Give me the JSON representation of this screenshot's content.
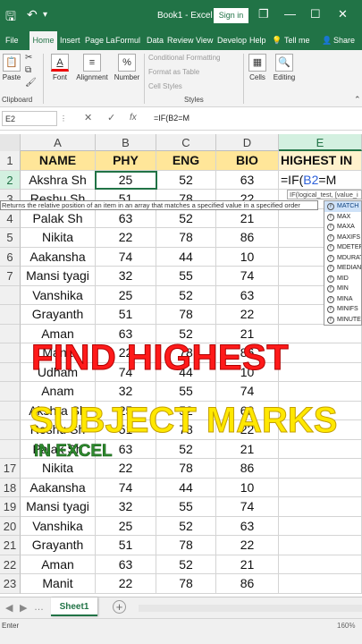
{
  "titlebar": {
    "title": "Book1 - Excel",
    "signin": "Sign in",
    "save_glyph": "🖫",
    "undo_glyph": "↶",
    "more_glyph": "▾",
    "restore_glyph": "❐",
    "minimize_glyph": "—",
    "maximize_glyph": "☐",
    "close_glyph": "✕",
    "bg_color": "#217346"
  },
  "menu": {
    "file": "File",
    "home": "Home",
    "insert": "Insert",
    "pagelayout": "Page La",
    "formulas": "Formul",
    "data": "Data",
    "review": "Review",
    "view": "View",
    "developer": "Develop",
    "help": "Help",
    "tellme": "Tell me",
    "share": "Share"
  },
  "ribbon": {
    "paste": "Paste",
    "clipboard": "Clipboard",
    "font": "Font",
    "alignment": "Alignment",
    "number": "Number",
    "conditional": "Conditional Formatting",
    "format_table": "Format as Table",
    "cell_styles": "Cell Styles",
    "styles": "Styles",
    "cells": "Cells",
    "editing": "Editing"
  },
  "formula_bar": {
    "name_box": "E2",
    "formula": "=IF(B2=M",
    "cancel_glyph": "✕",
    "enter_glyph": "✓",
    "fx": "fx"
  },
  "columns": [
    "A",
    "B",
    "C",
    "D",
    "E"
  ],
  "rows": [
    {
      "n": "1",
      "a": "NAME",
      "b": "PHY",
      "c": "ENG",
      "d": "BIO",
      "e": "HIGHEST IN"
    },
    {
      "n": "2",
      "a": "Akshra Sh",
      "b": "25",
      "c": "52",
      "d": "63",
      "e": "=IF(B2=M"
    },
    {
      "n": "3",
      "a": "Reshu Sh",
      "b": "51",
      "c": "78",
      "d": "22",
      "e": ""
    },
    {
      "n": "4",
      "a": "Palak Sh",
      "b": "63",
      "c": "52",
      "d": "21",
      "e": ""
    },
    {
      "n": "5",
      "a": "Nikita",
      "b": "22",
      "c": "78",
      "d": "86",
      "e": ""
    },
    {
      "n": "6",
      "a": "Aakansha",
      "b": "74",
      "c": "44",
      "d": "10",
      "e": ""
    },
    {
      "n": "7",
      "a": "Mansi tyagi",
      "b": "32",
      "c": "55",
      "d": "74",
      "e": ""
    },
    {
      "n": "",
      "a": "Vanshika",
      "b": "25",
      "c": "52",
      "d": "63",
      "e": ""
    },
    {
      "n": "",
      "a": "Grayanth",
      "b": "51",
      "b2": "",
      "c": "78",
      "d": "22",
      "e": ""
    },
    {
      "n": "",
      "a": "Aman",
      "b": "63",
      "c": "52",
      "d": "21",
      "e": ""
    },
    {
      "n": "",
      "a": "Manit",
      "b": "22",
      "c": "78",
      "d": "86",
      "e": ""
    },
    {
      "n": "",
      "a": "Udham",
      "b": "74",
      "c": "44",
      "d": "10",
      "e": ""
    },
    {
      "n": "",
      "a": "Anam",
      "b": "32",
      "c": "55",
      "d": "74",
      "e": ""
    },
    {
      "n": "",
      "a": "Akshra Sh",
      "b": "25",
      "c": "52",
      "d": "63",
      "e": ""
    },
    {
      "n": "",
      "a": "Reshu Sh",
      "b": "51",
      "c": "78",
      "d": "22",
      "e": ""
    },
    {
      "n": "",
      "a": "Palak Sh",
      "b": "63",
      "c": "52",
      "d": "21",
      "e": ""
    },
    {
      "n": "17",
      "a": "Nikita",
      "b": "22",
      "c": "78",
      "d": "86",
      "e": ""
    },
    {
      "n": "18",
      "a": "Aakansha",
      "b": "74",
      "c": "44",
      "d": "10",
      "e": ""
    },
    {
      "n": "19",
      "a": "Mansi tyagi",
      "b": "32",
      "c": "55",
      "d": "74",
      "e": ""
    },
    {
      "n": "20",
      "a": "Vanshika",
      "b": "25",
      "c": "52",
      "d": "63",
      "e": ""
    },
    {
      "n": "21",
      "a": "Grayanth",
      "b": "51",
      "c": "78",
      "d": "22",
      "e": ""
    },
    {
      "n": "22",
      "a": "Aman",
      "b": "63",
      "c": "52",
      "d": "21",
      "e": ""
    },
    {
      "n": "23",
      "a": "Manit",
      "b": "22",
      "c": "78",
      "d": "86",
      "e": ""
    }
  ],
  "tooltip": "Returns the relative position of an item in an array that matches a specified value in a specified order",
  "arg_hint": "IF(logical_test, [value_i",
  "autocomplete": [
    "MATCH",
    "MAX",
    "MAXA",
    "MAXIFS",
    "MDETERM",
    "MDURATION",
    "MEDIAN",
    "MID",
    "MIN",
    "MINA",
    "MINIFS",
    "MINUTE"
  ],
  "overlay": {
    "line1": "FIND HIGHEST",
    "line2": "SUBJECT MARKS",
    "line3": "IN EXCEL"
  },
  "sheets": {
    "tab": "Sheet1",
    "add": "+",
    "prev": "◀",
    "next": "▶",
    "more": "…"
  },
  "status": {
    "mode": "Enter",
    "zoom": "160%"
  },
  "colors": {
    "excel_green": "#217346",
    "header_fill": "#ffe699",
    "overlay_red": "#ff1a1a",
    "overlay_yellow": "#ffe800",
    "overlay_green": "#2f8a2f"
  }
}
